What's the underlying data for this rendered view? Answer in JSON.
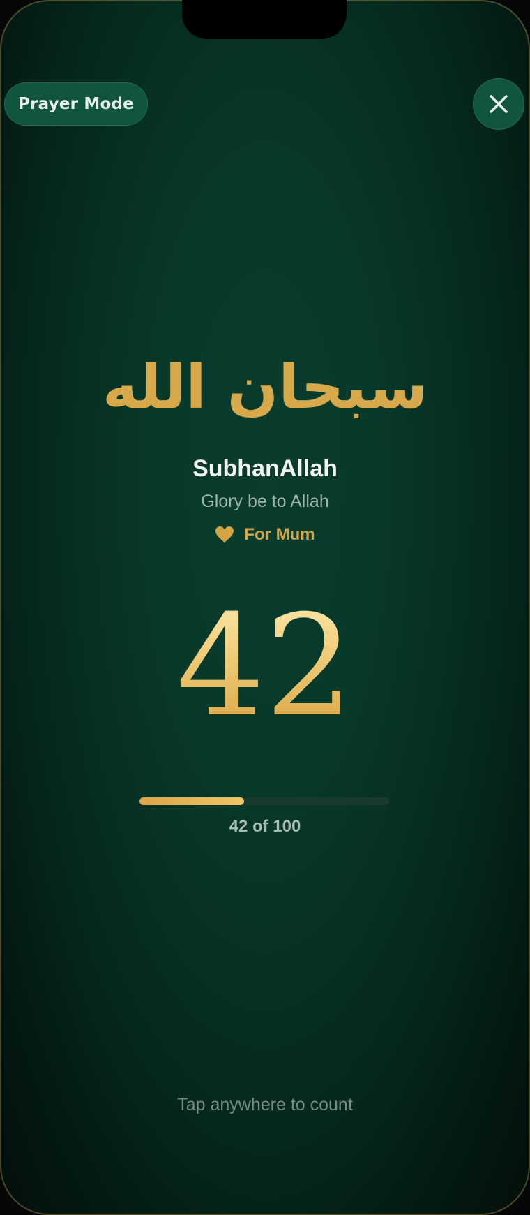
{
  "header": {
    "mode_label": "Prayer Mode",
    "close_icon": "close-icon"
  },
  "dhikr": {
    "arabic": "سبحان الله",
    "transliteration": "SubhanAllah",
    "meaning": "Glory be to Allah",
    "dedication_icon": "heart-icon",
    "dedication": "For Mum"
  },
  "counter": {
    "count": "42",
    "current": 42,
    "target": 100,
    "progress_text": "42 of 100"
  },
  "footer": {
    "hint": "Tap anywhere to count"
  },
  "colors": {
    "gold": "#d8a94a",
    "background": "#0a3d2e",
    "pill": "#11553f"
  }
}
